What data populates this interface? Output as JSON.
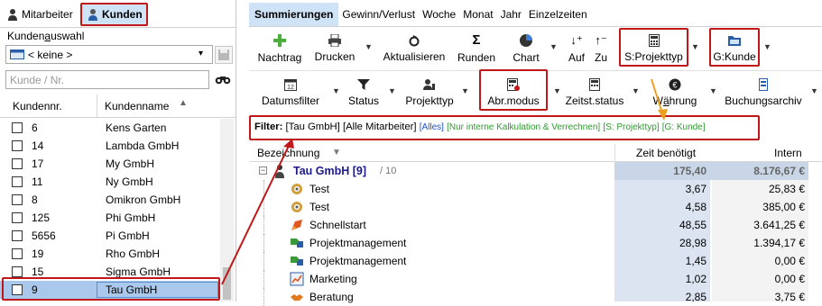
{
  "left_tabs": [
    {
      "label": "Mitarbeiter",
      "icon": "person-icon"
    },
    {
      "label": "Kunden",
      "icon": "customer-icon"
    }
  ],
  "left_panel": {
    "label_pre": "Kunden",
    "label_underlined": "a",
    "label_post": "uswahl",
    "select_value": "< keine >",
    "search_placeholder": "Kunde / Nr.",
    "col_number": "Kundennr.",
    "col_name": "Kundenname",
    "rows": [
      {
        "nr": "6",
        "name": "Kens Garten"
      },
      {
        "nr": "14",
        "name": "Lambda GmbH"
      },
      {
        "nr": "17",
        "name": "My GmbH"
      },
      {
        "nr": "11",
        "name": "Ny GmbH"
      },
      {
        "nr": "8",
        "name": "Omikron GmbH"
      },
      {
        "nr": "125",
        "name": "Phi GmbH"
      },
      {
        "nr": "5656",
        "name": "Pi GmbH"
      },
      {
        "nr": "19",
        "name": "Rho GmbH"
      },
      {
        "nr": "15",
        "name": "Sigma GmbH"
      },
      {
        "nr": "9",
        "name": "Tau GmbH"
      }
    ]
  },
  "right_tabs": [
    "Summierungen",
    "Gewinn/Verlust",
    "Woche",
    "Monat",
    "Jahr",
    "Einzelzeiten"
  ],
  "toolbar1": {
    "nachtrag": "Nachtrag",
    "drucken": "Drucken",
    "aktualisieren": "Aktualisieren",
    "runden": "Runden",
    "chart": "Chart",
    "auf": "Auf",
    "zu": "Zu",
    "s_projekttyp": "S:Projekttyp",
    "g_kunde": "G:Kunde"
  },
  "toolbar2": {
    "datumsfilter": "Datumsfilter",
    "status": "Status",
    "projekttyp": "Projekttyp",
    "abrmodus": "Abr.modus",
    "zeitststatus": "Zeitst.status",
    "waehrung_pre": "W",
    "waehrung_underlined": "ä",
    "waehrung_post": "hrung",
    "buchungsarchiv": "Buchungsarchiv"
  },
  "filter": {
    "label": "Filter:",
    "part1": "[Tau GmbH] [Alle Mitarbeiter]",
    "part2": "[Alles]",
    "part3": "[Nur interne Kalkulation & Verrechnen]",
    "part4": "[S: Projekttyp]",
    "part5": "[G: Kunde]",
    "colors": {
      "black": "#000000",
      "blue": "#1a4fd8",
      "green": "#2e9a2e"
    }
  },
  "table": {
    "col_bezeichnung": "Bezeichnung",
    "col_zeit": "Zeit benötigt",
    "col_intern": "Intern",
    "group": {
      "name": "Tau GmbH [9]",
      "count": "/ 10",
      "zeit": "175,40",
      "intern": "8.176,67 €"
    },
    "rows": [
      {
        "name": "Test",
        "zeit": "3,67",
        "intern": "25,83 €",
        "icon": "gear-people-icon"
      },
      {
        "name": "Test",
        "zeit": "4,58",
        "intern": "385,00 €",
        "icon": "gear-people-icon"
      },
      {
        "name": "Schnellstart",
        "zeit": "48,55",
        "intern": "3.641,25 €",
        "icon": "rocket-icon"
      },
      {
        "name": "Projektmanagement",
        "zeit": "28,98",
        "intern": "1.394,17 €",
        "icon": "puzzle-icon"
      },
      {
        "name": "Projektmanagement",
        "zeit": "1,45",
        "intern": "0,00 €",
        "icon": "puzzle-icon"
      },
      {
        "name": "Marketing",
        "zeit": "1,02",
        "intern": "0,00 €",
        "icon": "chart-icon"
      },
      {
        "name": "Beratung",
        "zeit": "2,85",
        "intern": "3,75 €",
        "icon": "handshake-icon"
      }
    ]
  },
  "colors": {
    "accent": "#c01818",
    "selection": "#cfe3f7",
    "arrow": "#f0a020",
    "header_bg": "#f0f0f0"
  }
}
